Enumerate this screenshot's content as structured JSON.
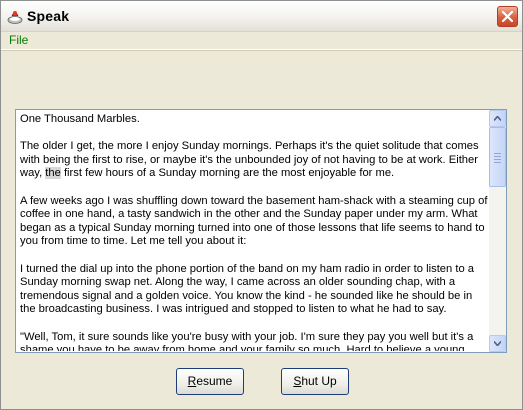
{
  "window": {
    "title": "Speak",
    "close_label": "close"
  },
  "menu": {
    "file": "File"
  },
  "document": {
    "paragraphs": [
      {
        "text": "One Thousand Marbles."
      },
      {
        "before": "The older I get, the more I enjoy Sunday mornings. Perhaps it's the quiet solitude that comes with being the first to rise, or maybe it's the unbounded joy of not having to be at work. Either way, ",
        "highlight": "the",
        "after": " first few hours of a Sunday morning are the most enjoyable for me."
      },
      {
        "text": "A few weeks ago I was shuffling down toward the basement ham-shack with a steaming cup of coffee in one hand, a tasty sandwich in the other and the Sunday paper under my arm. What began as a typical Sunday morning turned into one of those lessons that life seems to hand to you from time to time. Let me tell you about it:"
      },
      {
        "text": "I turned the dial up into the phone portion of the band on my ham radio in order to listen to a Sunday morning swap net. Along the way, I came across an older sounding chap, with a tremendous signal and a golden voice. You know the kind - he sounded like he should be in the broadcasting business. I was intrigued and stopped to listen to what he had to say."
      },
      {
        "text": "\"Well, Tom, it sure sounds like you're busy with your job. I'm sure they pay you well but it's a shame you have to be away from home and your family so much. Hard to believe a young fellow should"
      }
    ]
  },
  "buttons": {
    "resume": {
      "mnemonic": "R",
      "rest": "esume"
    },
    "shutup": {
      "mnemonic": "S",
      "rest": "hut Up"
    }
  }
}
